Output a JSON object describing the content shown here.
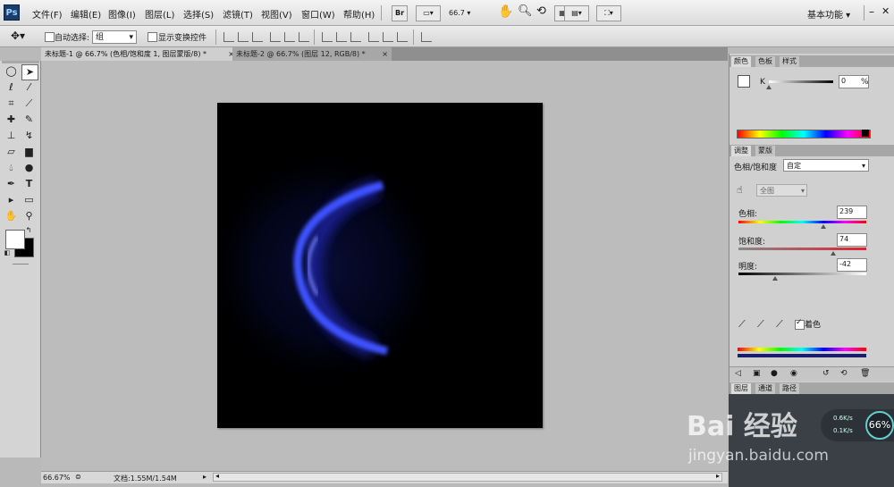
{
  "app": {
    "logo": "Ps"
  },
  "menu": [
    "文件(F)",
    "编辑(E)",
    "图像(I)",
    "图层(L)",
    "选择(S)",
    "滤镜(T)",
    "视图(V)",
    "窗口(W)",
    "帮助(H)"
  ],
  "appbar": {
    "bridge_label": "Br",
    "zoom_value": "66.7",
    "workspace": "基本功能"
  },
  "options": {
    "auto_select_label": "自动选择:",
    "auto_select_value": "组",
    "show_transform_label": "显示变换控件"
  },
  "tabs": [
    {
      "label": "未标题-1 @ 66.7% (色相/饱和度 1, 图层蒙版/8) *",
      "close": "×"
    },
    {
      "label": "未标题-2 @ 66.7% (图层 12, RGB/8) *",
      "close": "×"
    }
  ],
  "status": {
    "zoom": "66.67%",
    "doc": "文档:1.55M/1.54M"
  },
  "color_panel": {
    "tabs": [
      "颜色",
      "色板",
      "样式"
    ],
    "channel_label": "K",
    "value": "0",
    "unit": "%"
  },
  "adjust_panel": {
    "tabs": [
      "调整",
      "蒙版"
    ],
    "title": "色相/饱和度",
    "preset": "自定",
    "channel": "全图",
    "hue_label": "色相:",
    "hue_value": "239",
    "hue": 239,
    "saturation_label": "饱和度:",
    "saturation_value": "74",
    "saturation": 74,
    "lightness_label": "明度:",
    "lightness_value": "-42",
    "lightness": -42,
    "colorize_label": "着色",
    "colorize_checked": true
  },
  "layers_panel": {
    "tabs": [
      "图层",
      "通道",
      "路径"
    ]
  },
  "overlay": {
    "speed_up": "0.6K/s",
    "speed_down": "0.1K/s",
    "percent": "66%"
  },
  "watermark": {
    "brand": "Bai 经验",
    "url": "jingyan.baidu.com"
  },
  "colors": {
    "glow": "#2a3cff",
    "accent": "#1b3d6b"
  }
}
